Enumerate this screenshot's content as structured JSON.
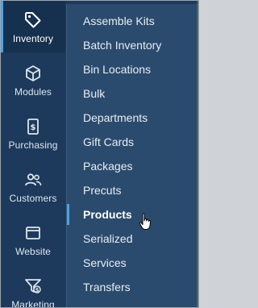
{
  "sidebar": {
    "items": [
      {
        "label": "Inventory",
        "icon": "tag-icon",
        "active": true
      },
      {
        "label": "Modules",
        "icon": "cube-icon",
        "active": false
      },
      {
        "label": "Purchasing",
        "icon": "invoice-dollar-icon",
        "active": false
      },
      {
        "label": "Customers",
        "icon": "users-icon",
        "active": false
      },
      {
        "label": "Website",
        "icon": "browser-window-icon",
        "active": false
      },
      {
        "label": "Marketing",
        "icon": "funnel-dollar-icon",
        "active": false
      }
    ]
  },
  "submenu": {
    "items": [
      {
        "label": "Assemble Kits"
      },
      {
        "label": "Batch Inventory"
      },
      {
        "label": "Bin Locations"
      },
      {
        "label": "Bulk"
      },
      {
        "label": "Departments"
      },
      {
        "label": "Gift Cards"
      },
      {
        "label": "Packages"
      },
      {
        "label": "Precuts"
      },
      {
        "label": "Products",
        "selected": true
      },
      {
        "label": "Serialized"
      },
      {
        "label": "Services"
      },
      {
        "label": "Transfers"
      }
    ]
  },
  "colors": {
    "sidebar_bg": "#1d3a5c",
    "active_bg": "#16314f",
    "submenu_bg": "#2b4b6e",
    "accent": "#4aa3e8"
  }
}
